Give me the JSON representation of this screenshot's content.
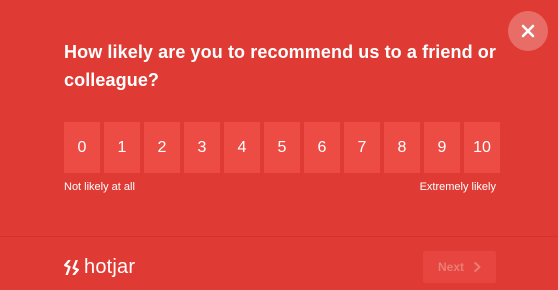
{
  "colors": {
    "background": "#df3a33",
    "scale_button": "#ed4c45",
    "close_button": "#e86d66",
    "next_button": "#e6463f",
    "next_text": "#eb7c76"
  },
  "survey": {
    "question": "How likely are you to recommend us to a friend or colleague?",
    "scale": [
      "0",
      "1",
      "2",
      "3",
      "4",
      "5",
      "6",
      "7",
      "8",
      "9",
      "10"
    ],
    "low_label": "Not likely at all",
    "high_label": "Extremely likely"
  },
  "footer": {
    "brand": "hotjar",
    "next_label": "Next",
    "next_disabled": true
  },
  "icons": {
    "close": "close-icon",
    "brand": "hotjar-logo-icon",
    "next": "chevron-right-icon"
  }
}
